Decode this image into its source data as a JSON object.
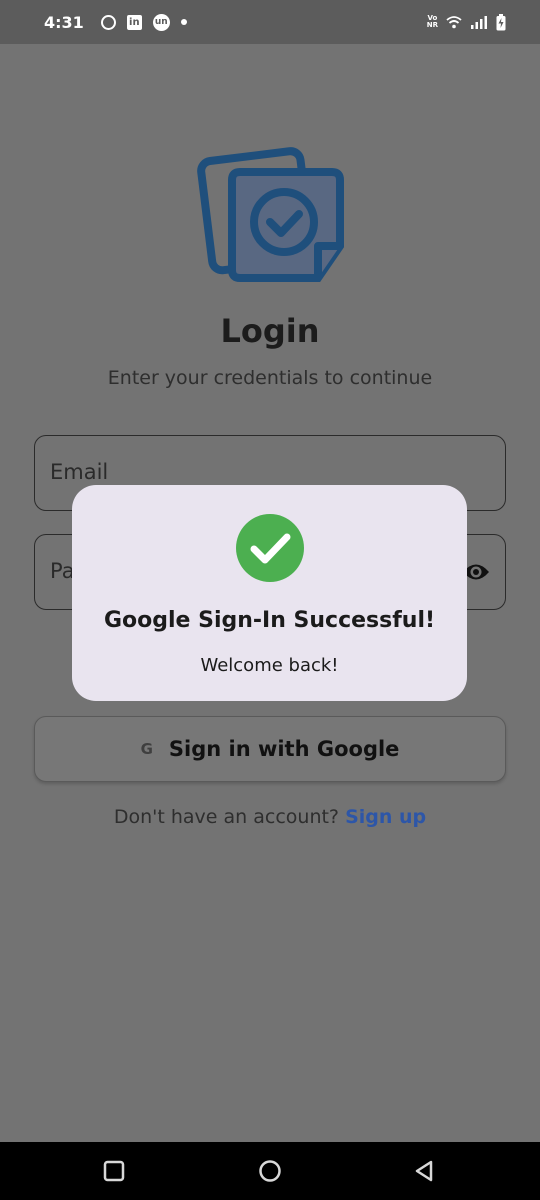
{
  "status_bar": {
    "time": "4:31",
    "notification_icons": [
      "circle-app-icon",
      "linkedin-icon",
      "unstop-icon",
      "dot-icon"
    ],
    "linkedin_text": "in",
    "unstop_text": "un",
    "vonr_top": "Vo",
    "vonr_bottom": "NR",
    "right_icons": [
      "vonr-icon",
      "wifi-icon",
      "signal-icon",
      "battery-charging-icon"
    ]
  },
  "login": {
    "title": "Login",
    "subtitle": "Enter your credentials to continue",
    "email_placeholder": "Email",
    "password_placeholder": "Password",
    "password_visible_part": "Pa",
    "google_button_label": "Sign in with Google",
    "google_icon_letter": "G",
    "signup_prompt": "Don't have an account?",
    "signup_link": "Sign up"
  },
  "modal": {
    "title": "Google Sign-In Successful!",
    "message": "Welcome back!"
  },
  "colors": {
    "overlay_background": "#737373",
    "status_bar": "#5c5c5c",
    "modal_background": "#e9e4ef",
    "success_green": "#4caf50",
    "logo_blue": "#1f4f7c",
    "link_blue": "#2d56a8"
  }
}
